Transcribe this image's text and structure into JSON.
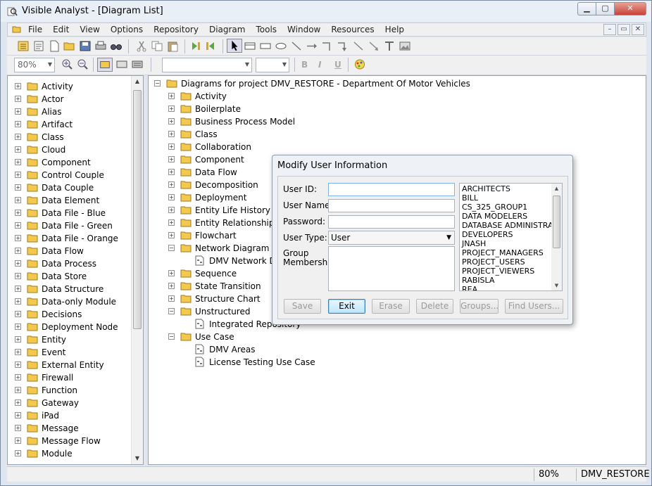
{
  "window": {
    "title": "Visible Analyst - [Diagram List]",
    "icon": "magnifier-app-icon"
  },
  "window_buttons": {
    "minimize": "▁",
    "maximize": "▢",
    "close": "✕"
  },
  "menubar": {
    "items": [
      "File",
      "Edit",
      "View",
      "Options",
      "Repository",
      "Diagram",
      "Tools",
      "Window",
      "Resources",
      "Help"
    ],
    "mdi_buttons": [
      "–",
      "▭",
      "✕"
    ]
  },
  "toolbar2": {
    "zoom": "80%",
    "font_name": "",
    "font_size": "",
    "bold": "B",
    "italic": "I",
    "underline": "U"
  },
  "left_tree": {
    "items": [
      "Activity",
      "Actor",
      "Alias",
      "Artifact",
      "Class",
      "Cloud",
      "Component",
      "Control Couple",
      "Data Couple",
      "Data Element",
      "Data File - Blue",
      "Data File - Green",
      "Data File - Orange",
      "Data Flow",
      "Data Process",
      "Data Store",
      "Data Structure",
      "Data-only Module",
      "Decisions",
      "Deployment Node",
      "Entity",
      "Event",
      "External Entity",
      "Firewall",
      "Function",
      "Gateway",
      "iPad",
      "Message",
      "Message Flow",
      "Module"
    ]
  },
  "right_tree": {
    "root": "Diagrams for project DMV_RESTORE - Department Of Motor Vehicles",
    "rows": [
      {
        "label": "Activity",
        "expander": "+"
      },
      {
        "label": "Boilerplate",
        "expander": "+"
      },
      {
        "label": "Business Process Model",
        "expander": "+"
      },
      {
        "label": "Class",
        "expander": "+"
      },
      {
        "label": "Collaboration",
        "expander": "+"
      },
      {
        "label": "Component",
        "expander": "+"
      },
      {
        "label": "Data Flow",
        "expander": "+"
      },
      {
        "label": "Decomposition",
        "expander": "+"
      },
      {
        "label": "Deployment",
        "expander": "+"
      },
      {
        "label": "Entity Life History",
        "expander": "+"
      },
      {
        "label": "Entity Relationship",
        "expander": "+"
      },
      {
        "label": "Flowchart",
        "expander": "+"
      },
      {
        "label": "Network Diagram",
        "expander": "−"
      },
      {
        "label": "DMV Network Diagram",
        "child": true
      },
      {
        "label": "Sequence",
        "expander": "+"
      },
      {
        "label": "State Transition",
        "expander": "+"
      },
      {
        "label": "Structure Chart",
        "expander": "+"
      },
      {
        "label": "Unstructured",
        "expander": "−"
      },
      {
        "label": "Integrated Repository",
        "child": true
      },
      {
        "label": "Use Case",
        "expander": "−"
      },
      {
        "label": "DMV Areas",
        "child": true
      },
      {
        "label": "License Testing Use Case",
        "child": true
      }
    ]
  },
  "dialog": {
    "title": "Modify User Information",
    "user_id_label": "User ID:",
    "user_id_value": "",
    "user_name_label": "User Name:",
    "user_name_value": "",
    "password_label": "Password:",
    "password_value": "",
    "user_type_label": "User Type:",
    "user_type_value": "User",
    "group_label_line1": "Group",
    "group_label_line2": "Membership:",
    "groups": [
      "ARCHITECTS",
      "BILL",
      "CS_325_GROUP1",
      "DATA MODELERS",
      "DATABASE ADMINISTRAT",
      "DEVELOPERS",
      "JNASH",
      "PROJECT_MANAGERS",
      "PROJECT_USERS",
      "PROJECT_VIEWERS",
      "RABISLA",
      "REA"
    ],
    "buttons": {
      "save": "Save",
      "exit": "Exit",
      "erase": "Erase",
      "delete": "Delete",
      "groups": "Groups...",
      "find_users": "Find Users..."
    }
  },
  "statusbar": {
    "zoom": "80%",
    "project": "DMV_RESTORE"
  },
  "colors": {
    "folder": "#f2c94c",
    "window_bg": "#dfe6ef",
    "focus_border": "#7eb4ea"
  }
}
